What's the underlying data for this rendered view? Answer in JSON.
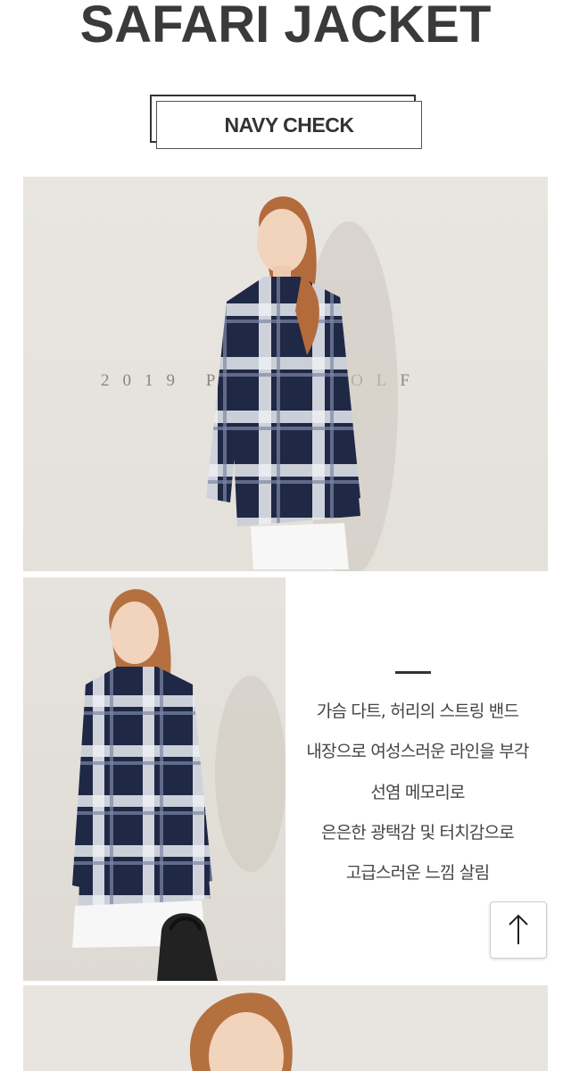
{
  "header": {
    "title": "SAFARI JACKET"
  },
  "badge": {
    "label": "NAVY CHECK"
  },
  "photo1": {
    "watermark": "2019 PUMA GOLF"
  },
  "description": {
    "lines": [
      "가슴 다트, 허리의 스트링 밴드",
      "내장으로 여성스러운 라인을 부각",
      "선염 메모리로",
      "은은한 광택감 및 터치감으로",
      "고급스러운 느낌 살림"
    ]
  },
  "scroll_top": {
    "icon": "arrow-up-icon"
  },
  "colors": {
    "navy": "#1f2845",
    "background": "#ffffff",
    "text": "#333333"
  }
}
